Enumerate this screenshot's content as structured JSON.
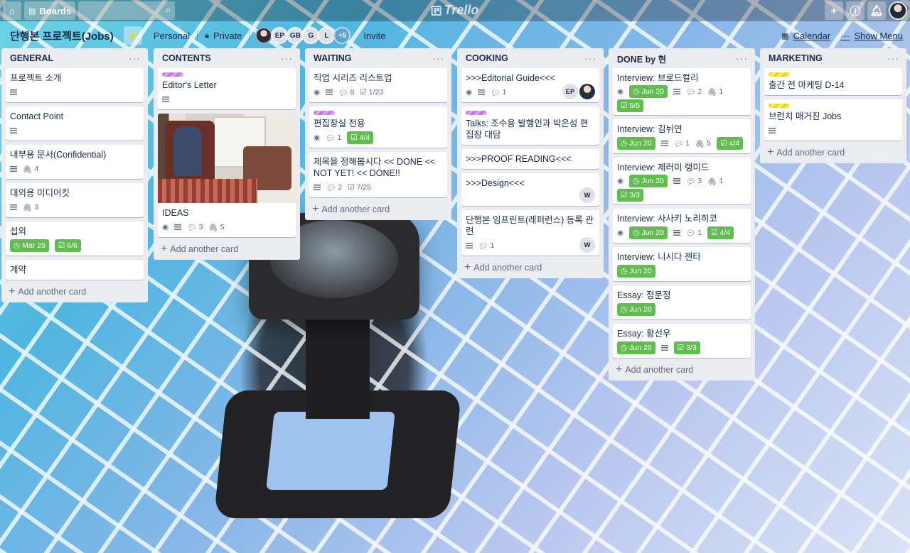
{
  "topbar": {
    "boards_label": "Boards",
    "logo_text": "Trello"
  },
  "board": {
    "title": "단행본 프로젝트(Jobs)",
    "team": "Personal",
    "visibility": "Private",
    "members": [
      "EP",
      "GB",
      "G",
      "L"
    ],
    "more_members": "+5",
    "invite": "Invite",
    "calendar": "Calendar",
    "show_menu": "Show Menu"
  },
  "add_card_label": "Add another card",
  "lists": [
    {
      "title": "GENERAL",
      "cards": [
        {
          "title": "프로젝트 소개"
        },
        {
          "title": "Contact Point"
        },
        {
          "title": "내부용 문서(Confidential)",
          "attachments": "4"
        },
        {
          "title": "대외용 미디어킷",
          "attachments": "3"
        },
        {
          "title": "섭외",
          "due": "Mar 29",
          "checklist": "6/6"
        },
        {
          "title": "계약"
        }
      ]
    },
    {
      "title": "CONTENTS",
      "cards": [
        {
          "title": "Editor's Letter"
        },
        {
          "title": "IDEAS",
          "comments": "3",
          "attachments": "5"
        }
      ]
    },
    {
      "title": "WAITING",
      "cards": [
        {
          "title": "직업 시리즈 리스트업",
          "comments": "8",
          "checklist": "1/23"
        },
        {
          "title": "편집장실 전용",
          "comments": "1",
          "checklist": "4/4"
        },
        {
          "title": "제목을 정해봅시다 << DONE << NOT YET! << DONE!!",
          "comments": "2",
          "checklist": "7/25"
        }
      ]
    },
    {
      "title": "COOKING",
      "cards": [
        {
          "title": ">>>Editorial Guide<<<",
          "comments": "1",
          "member": "EP"
        },
        {
          "title": "Talks: 조수용 발행인과 박은성 편집장 대담"
        },
        {
          "title": ">>>PROOF READING<<<"
        },
        {
          "title": ">>>Design<<<",
          "member": "W"
        },
        {
          "title": "단행본 임프린트(레퍼런스) 등록 관련",
          "comments": "1",
          "member": "W"
        }
      ]
    },
    {
      "title": "DONE by 현",
      "cards": [
        {
          "title": "Interview: 브로드컬리",
          "due": "Jun 20",
          "comments": "2",
          "attachments": "1",
          "checklist": "5/5"
        },
        {
          "title": "Interview: 김뉘연",
          "due": "Jun 20",
          "comments": "1",
          "attachments": "5",
          "checklist": "4/4"
        },
        {
          "title": "Interview: 제러미 랭미드",
          "due": "Jun 20",
          "comments": "3",
          "attachments": "1",
          "checklist": "3/3"
        },
        {
          "title": "Interview: 사사키 노리히코",
          "due": "Jun 20",
          "comments": "1",
          "checklist": "4/4"
        },
        {
          "title": "Interview: 니시다 젠타",
          "due": "Jun 20"
        },
        {
          "title": "Essay: 정문정",
          "due": "Jun 20"
        },
        {
          "title": "Essay: 황선우",
          "due": "Jun 20",
          "checklist": "3/3"
        }
      ]
    },
    {
      "title": "MARKETING",
      "cards": [
        {
          "title": "출간 전 마케팅 D-14"
        },
        {
          "title": "브런치 매거진 Jobs"
        }
      ]
    }
  ],
  "colors": {
    "label_green": "#61bd4f",
    "label_purple": "#c377e0",
    "label_yellow": "#f2d600"
  }
}
